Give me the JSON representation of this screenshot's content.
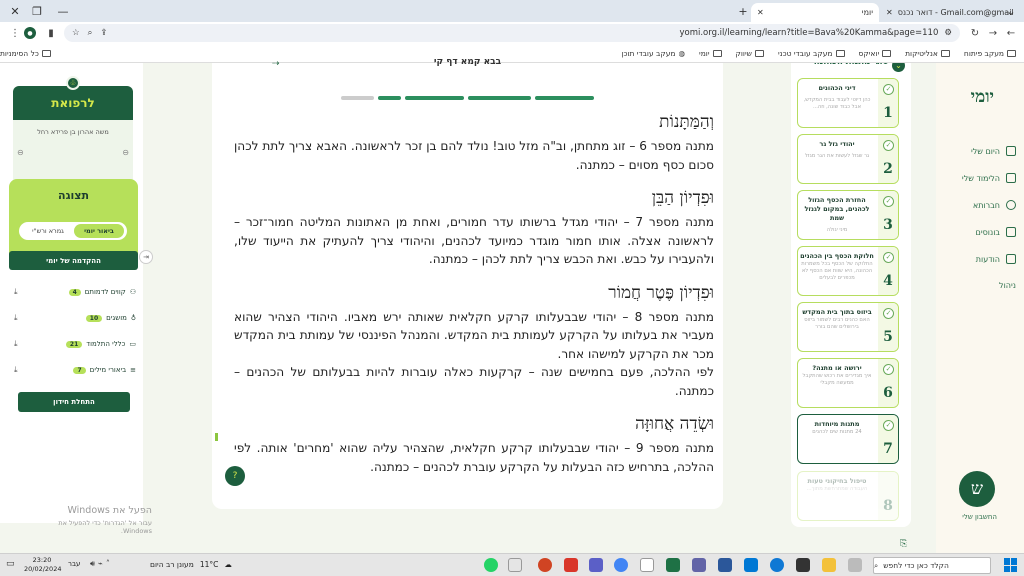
{
  "browser": {
    "tabs": [
      {
        "label": "דואר נכנס - Gmail.com@gmail.com",
        "active": false
      },
      {
        "label": "יומי",
        "active": true
      }
    ],
    "url": "yomi.org.il/learning/learn?title=Bava%20Kamma&page=110",
    "bookmarks": [
      "מעקב פיתוח",
      "אנליטיקות",
      "יואיקס",
      "מעקב עובדי טכני",
      "שיווק",
      "יומי",
      "מעקב עובדי תוכן",
      "כל הסימניות"
    ]
  },
  "sidebar_right": {
    "logo": "יומי",
    "items": [
      "היום שלי",
      "הלימוד שלי",
      "חברותא",
      "בונוסים",
      "הודעות",
      "ניהול"
    ],
    "avatar_letter": "ש",
    "account_label": "החשבון שלי"
  },
  "strip": {
    "header": "סוגי מתנות הכהונה",
    "cards": [
      {
        "num": "1",
        "title": "דיני הכהונים",
        "sub": "כהן דיוטי לעבוד בבית המקדש, אבל כבוד שונה, וזה..."
      },
      {
        "num": "2",
        "title": "יהודי גזל גר",
        "sub": "גר שגזל לעשות את הגר מגזל"
      },
      {
        "num": "3",
        "title": "החזרת הכסף הגזול לכהנים, במקום לגנזל שמת",
        "sub": "מיני יגולה"
      },
      {
        "num": "4",
        "title": "חלוקת הכסף בין הכהנים",
        "sub": "החלוקה של הכסף בכל משמרות הכהונה, היא שוות אם הכסף לא מכפרים לבעלים"
      },
      {
        "num": "5",
        "title": "ביזוס בתוך בית המקדש",
        "sub": "האם כהנים רבים לשמור ביזוס בירושלים שהם בורר"
      },
      {
        "num": "6",
        "title": "ירושה או מתנה?",
        "sub": "איך מגדירים את רכוש שהתקבל ממעשה מקבלי"
      },
      {
        "num": "7",
        "title": "מתנות מיוחדות",
        "sub": "24 מתנות שים לכהנים"
      },
      {
        "num": "8",
        "title": "טיפול בחיקוני טעות",
        "sub": "העבודה שמתרחשת מתוך..."
      }
    ]
  },
  "main": {
    "top_title": "בבא קמא דף קי",
    "sections": [
      {
        "heading": "וְהַמַּתָּנוֹת",
        "paragraphs": [
          "מתנה מספר 6 – זוג מתחתן, וב\"ה מזל טוב! נולד להם בן זכר לראשונה. האבא צריך לתת לכהן סכום כסף מסוים – כמתנה."
        ]
      },
      {
        "heading": "וּפִדְיוֹן הַבֵּן",
        "paragraphs": [
          "מתנה מספר 7 – יהודי מגדל ברשותו עדר חמורים, ואחת מן האתונות המליטה חמור־זכר – לראשונה אצלה. אותו חמור מוגדר כמיועד לכהנים, והיהודי צריך להעתיק את הייעוד שלו, ולהעבירו על כבש. ואת הכבש צריך לתת לכהן – כמתנה."
        ]
      },
      {
        "heading": "וּפִדְיוֹן פֶּטֶר חֲמוֹר",
        "paragraphs": [
          "מתנה מספר 8 – יהודי שבבעלותו קרקע חקלאית שאותה ירש מאביו. היהודי הצהיר שהוא מעביר את בעלותו על הקרקע לעמותת בית המקדש. והמנהל הפיננסי של עמותת בית המקדש מכר את הקרקע למישהו אחר.",
          "לפי ההלכה, פעם בחמישים שנה – קרקעות כאלה עוברות להיות בבעלותם של הכהנים – כמתנה."
        ]
      },
      {
        "heading": "וּשְׂדֵה אֲחוּזָּה",
        "paragraphs": [
          "מתנה מספר 9 – יהודי שבבעלותו קרקע חקלאית, שהצהיר עליה שהוא 'מחרים' אותה. לפי ההלכה, בתרחיש כזה הבעלות על הקרקע עוברת לכהנים – כמתנה."
        ]
      }
    ]
  },
  "sidebar_left": {
    "donate_title": "לרפואת",
    "donate_sub": "משה אהרון בן פרידא רחל",
    "display_title": "תצוגה",
    "toggle_on": "ביאור יומי",
    "toggle_off": "גמרא ורש\"י",
    "intro_button": "ההקדמה של יומי",
    "rows": [
      {
        "label": "קווים לדמותם",
        "count": "4"
      },
      {
        "label": "מושגים",
        "count": "10"
      },
      {
        "label": "כללי התלמוד",
        "count": "21"
      },
      {
        "label": "ביאורי מילים",
        "count": "7"
      }
    ],
    "start_button": "התחלת חידון"
  },
  "windows": {
    "activate_title": "הפעל את Windows",
    "activate_sub": "עבור אל 'הגדרות' כדי להפעיל את Windows."
  },
  "taskbar": {
    "search_placeholder": "הקלד כאן כדי לחפש",
    "weather": "מעונן רב היום",
    "temp": "11°C",
    "lang": "עבר",
    "time": "23:20",
    "date": "20/02/2024"
  },
  "colors": {
    "brand_dark": "#1d5e3e",
    "brand_lime": "#b6e05a",
    "accent_yellow": "#d5e84a"
  }
}
